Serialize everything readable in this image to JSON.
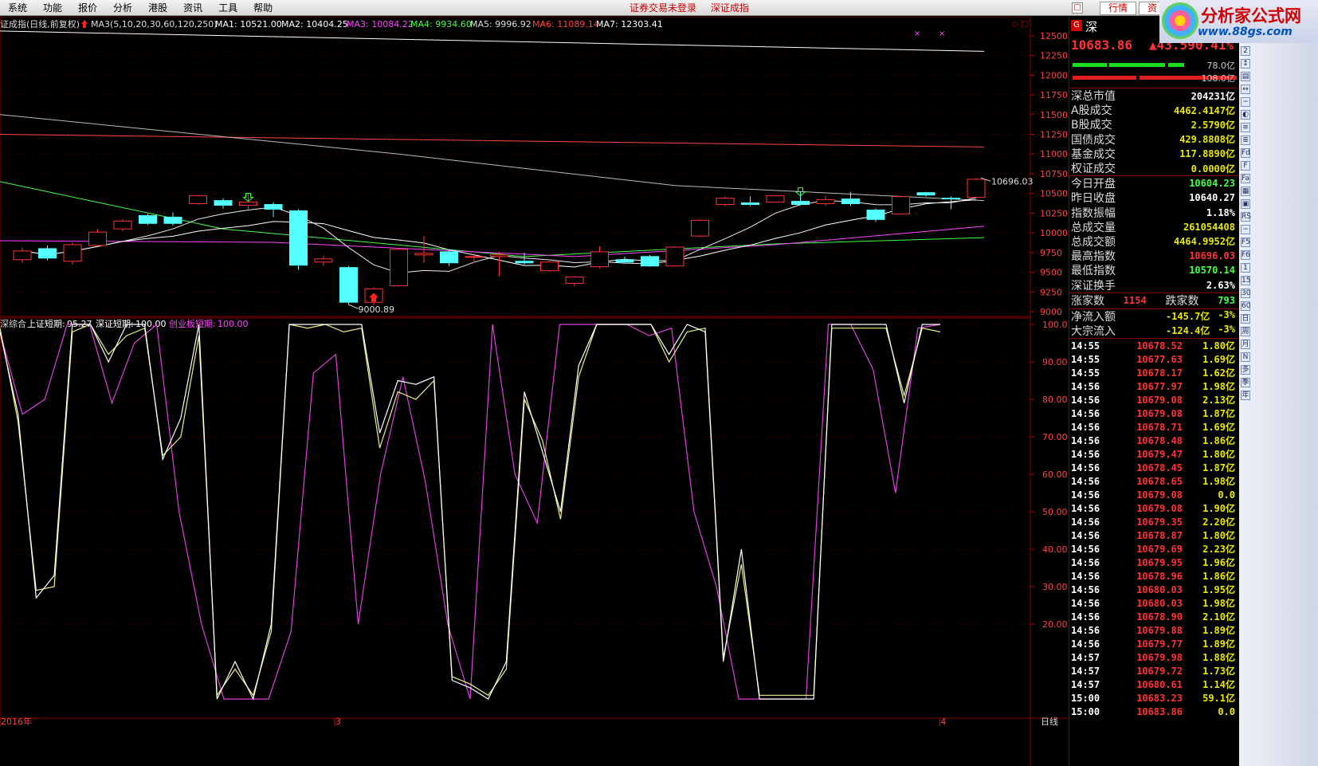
{
  "menu": {
    "items": [
      "系统",
      "功能",
      "报价",
      "分析",
      "港股",
      "资讯",
      "工具",
      "帮助"
    ],
    "status1": "证券交易未登录",
    "status2": "深证成指",
    "tabs": [
      "行情",
      "资"
    ],
    "win_close": "□"
  },
  "logo": {
    "title": "分析家公式网",
    "url": "www.88gs.com"
  },
  "chart": {
    "title": "证成指(日线,前复权)",
    "ma_legend": [
      {
        "text": "MA3(5,10,20,30,60,120,250)",
        "color": "#dddddd"
      },
      {
        "text": "MA1: 10521.00",
        "color": "#ffffff"
      },
      {
        "text": "MA2: 10404.25",
        "color": "#ffffff"
      },
      {
        "text": "MA3: 10084.22",
        "color": "#ff44ff"
      },
      {
        "text": "MA4: 9934.60",
        "color": "#44ff44"
      },
      {
        "text": "MA5: 9996.92",
        "color": "#dddddd"
      },
      {
        "text": "MA6: 11089.14",
        "color": "#ff4444"
      },
      {
        "text": "MA7: 12303.41",
        "color": "#ffffff"
      }
    ],
    "price_axis": [
      "12500",
      "12250",
      "12000",
      "11750",
      "11500",
      "11250",
      "11000",
      "10750",
      "10500",
      "10250",
      "10000",
      "9750",
      "9500",
      "9250",
      "9000"
    ],
    "price_range": [
      8950,
      12620
    ],
    "high_label": "10696.03",
    "low_label": "9000.89",
    "candles": [
      [
        9660,
        9770,
        9620,
        9810
      ],
      [
        9800,
        9680,
        9650,
        9840
      ],
      [
        9640,
        9850,
        9600,
        9880
      ],
      [
        9840,
        10010,
        9830,
        10050
      ],
      [
        10050,
        10150,
        10020,
        10170
      ],
      [
        10220,
        10120,
        10100,
        10240
      ],
      [
        10200,
        10120,
        10090,
        10260
      ],
      [
        10370,
        10470,
        10360,
        10480
      ],
      [
        10410,
        10350,
        10310,
        10440
      ],
      [
        10350,
        10390,
        10300,
        10500
      ],
      [
        10360,
        10300,
        10200,
        10390
      ],
      [
        10280,
        9590,
        9530,
        10300
      ],
      [
        9630,
        9670,
        9580,
        9710
      ],
      [
        9560,
        9120,
        9090,
        9580
      ],
      [
        9120,
        9290,
        9080,
        9310
      ],
      [
        9330,
        9790,
        9320,
        9800
      ],
      [
        9720,
        9740,
        9620,
        9960
      ],
      [
        9760,
        9620,
        9580,
        9790
      ],
      [
        9690,
        9700,
        9620,
        9740
      ],
      [
        9700,
        9720,
        9450,
        9760
      ],
      [
        9640,
        9620,
        9600,
        9750
      ],
      [
        9520,
        9630,
        9510,
        9660
      ],
      [
        9360,
        9440,
        9320,
        9450
      ],
      [
        9570,
        9760,
        9550,
        9830
      ],
      [
        9660,
        9630,
        9610,
        9700
      ],
      [
        9700,
        9580,
        9570,
        9720
      ],
      [
        9580,
        9820,
        9570,
        9830
      ],
      [
        9960,
        10160,
        9950,
        10170
      ],
      [
        10360,
        10440,
        10340,
        10460
      ],
      [
        10380,
        10360,
        10340,
        10460
      ],
      [
        10390,
        10470,
        10380,
        10480
      ],
      [
        10400,
        10360,
        10350,
        10520
      ],
      [
        10370,
        10420,
        10340,
        10470
      ],
      [
        10430,
        10370,
        10340,
        10520
      ],
      [
        10290,
        10170,
        10140,
        10310
      ],
      [
        10240,
        10460,
        10230,
        10470
      ],
      [
        10510,
        10480,
        10460,
        10520
      ],
      [
        10440,
        10430,
        10300,
        10460
      ],
      [
        10450,
        10680,
        10440,
        10696
      ]
    ],
    "arrows_down": [
      [
        9,
        10400
      ],
      [
        31,
        10470
      ]
    ],
    "arrow_up": [
      14,
      9240
    ],
    "osc_title": "深综合",
    "osc_series": [
      {
        "name": "上证短期",
        "value": "95.27",
        "color": "#ffffff"
      },
      {
        "name": "深证短期",
        "value": "100.00",
        "color": "#ffffff"
      },
      {
        "name": "创业板短期",
        "value": "100.00",
        "color": "#ff44ff"
      }
    ],
    "osc_axis": [
      "100.0",
      "90.00",
      "80.00",
      "70.00",
      "60.00",
      "50.00",
      "40.00",
      "30.00",
      "20.00"
    ],
    "osc_white": [
      98,
      76,
      27,
      33,
      100,
      100,
      90,
      100,
      100,
      64,
      75,
      100,
      0,
      10,
      0,
      20,
      100,
      100,
      100,
      100,
      100,
      71,
      85,
      84,
      86,
      5,
      3,
      0,
      10,
      82,
      66,
      50,
      89,
      100,
      100,
      100,
      100,
      92,
      100,
      98,
      10,
      40,
      0,
      0,
      0,
      0,
      100,
      100,
      100,
      100,
      79,
      100,
      100
    ],
    "osc_yellow": [
      99,
      74,
      29,
      30,
      98,
      100,
      92,
      97,
      99,
      65,
      70,
      97,
      1,
      8,
      1,
      18,
      100,
      99,
      100,
      98,
      99,
      67,
      82,
      80,
      85,
      6,
      4,
      1,
      8,
      80,
      69,
      48,
      86,
      100,
      100,
      100,
      100,
      90,
      98,
      99,
      11,
      36,
      1,
      1,
      1,
      1,
      99,
      99,
      99,
      99,
      81,
      99,
      98
    ],
    "osc_purple": [
      98,
      76,
      80,
      100,
      100,
      79,
      95,
      100,
      50,
      20,
      0,
      0,
      0,
      18,
      87,
      92,
      20,
      60,
      86,
      58,
      20,
      0,
      100,
      60,
      47,
      100,
      100,
      100,
      100,
      97,
      99,
      50,
      30,
      0,
      0,
      0,
      0,
      100,
      100,
      88,
      55,
      99,
      100
    ],
    "x_labels": [
      {
        "t": "2016年",
        "i": 0
      },
      {
        "t": "3",
        "i": 12.5
      },
      {
        "t": "4",
        "i": 35.1
      }
    ],
    "period": "日线"
  },
  "side": {
    "market": "深",
    "code_badge": "G",
    "price": "10683.86",
    "change": "▲43.59",
    "pct": "0.41%",
    "bar1": "78.0亿",
    "bar2": "108.0亿",
    "rows1": [
      {
        "k": "深总市值",
        "v": "204231亿",
        "c": "#ffffff"
      },
      {
        "k": "A股成交",
        "v": "4462.4147亿",
        "c": "#e8e800"
      },
      {
        "k": "B股成交",
        "v": "2.5790亿",
        "c": "#e8e800"
      },
      {
        "k": "国债成交",
        "v": "429.8808亿",
        "c": "#e8e800"
      },
      {
        "k": "基金成交",
        "v": "117.8890亿",
        "c": "#e8e800"
      },
      {
        "k": "权证成交",
        "v": "0.0000亿",
        "c": "#e8e800"
      }
    ],
    "rows2": [
      {
        "k": "今日开盘",
        "v": "10604.23",
        "c": "#44ff44"
      },
      {
        "k": "昨日收盘",
        "v": "10640.27",
        "c": "#ffffff"
      },
      {
        "k": "指数振幅",
        "v": "1.18%",
        "c": "#ffffff"
      },
      {
        "k": "总成交量",
        "v": "261054408",
        "c": "#e8e800"
      },
      {
        "k": "总成交额",
        "v": "4464.9952亿",
        "c": "#e8e800"
      },
      {
        "k": "最高指数",
        "v": "10696.03",
        "c": "#ff3333"
      },
      {
        "k": "最低指数",
        "v": "10570.14",
        "c": "#44ff44"
      },
      {
        "k": "深证换手",
        "v": "2.63%",
        "c": "#ffffff"
      }
    ],
    "updown": {
      "up_label": "涨家数",
      "up": "1154",
      "down_label": "跌家数",
      "down": "793"
    },
    "flows": [
      {
        "k": "净流入额",
        "v": "-145.7亿",
        "p": "-3%"
      },
      {
        "k": "大宗流入",
        "v": "-124.4亿",
        "p": "-3%"
      }
    ],
    "ticks": [
      [
        "14:55",
        "10678.52",
        "1.80亿"
      ],
      [
        "14:55",
        "10677.63",
        "1.69亿"
      ],
      [
        "14:55",
        "10678.17",
        "1.62亿"
      ],
      [
        "14:56",
        "10677.97",
        "1.98亿"
      ],
      [
        "14:56",
        "10679.08",
        "2.13亿"
      ],
      [
        "14:56",
        "10679.08",
        "1.87亿"
      ],
      [
        "14:56",
        "10678.71",
        "1.69亿"
      ],
      [
        "14:56",
        "10678.48",
        "1.86亿"
      ],
      [
        "14:56",
        "10679.47",
        "1.80亿"
      ],
      [
        "14:56",
        "10678.45",
        "1.87亿"
      ],
      [
        "14:56",
        "10678.65",
        "1.98亿"
      ],
      [
        "14:56",
        "10679.08",
        "0.0"
      ],
      [
        "14:56",
        "10679.08",
        "1.90亿"
      ],
      [
        "14:56",
        "10679.35",
        "2.20亿"
      ],
      [
        "14:56",
        "10678.87",
        "1.80亿"
      ],
      [
        "14:56",
        "10679.69",
        "2.23亿"
      ],
      [
        "14:56",
        "10679.95",
        "1.96亿"
      ],
      [
        "14:56",
        "10678.96",
        "1.86亿"
      ],
      [
        "14:56",
        "10680.03",
        "1.95亿"
      ],
      [
        "14:56",
        "10680.03",
        "1.98亿"
      ],
      [
        "14:56",
        "10678.90",
        "2.10亿"
      ],
      [
        "14:56",
        "10679.88",
        "1.89亿"
      ],
      [
        "14:56",
        "10679.77",
        "1.89亿"
      ],
      [
        "14:57",
        "10679.98",
        "1.88亿"
      ],
      [
        "14:57",
        "10679.72",
        "1.73亿"
      ],
      [
        "14:57",
        "10680.61",
        "1.14亿"
      ],
      [
        "15:00",
        "10683.23",
        "59.1亿"
      ],
      [
        "15:00",
        "10683.86",
        "0.0"
      ]
    ]
  },
  "toolbar": [
    "2",
    "↕",
    "▤",
    "↔",
    "~",
    "◐",
    "≡",
    "≣",
    "Fd",
    "F",
    "Fa",
    "▦",
    "▣",
    "RS",
    "~",
    "F5",
    "F6",
    "1",
    "15",
    "30",
    "60",
    "日",
    "周",
    "月",
    "N",
    "多",
    "季",
    "年"
  ]
}
